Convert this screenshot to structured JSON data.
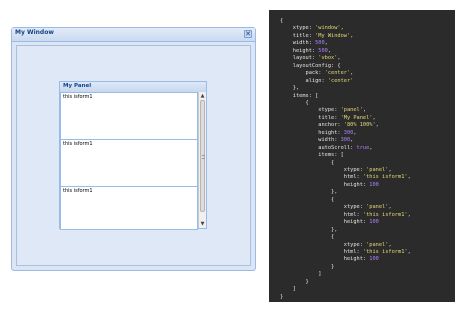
{
  "window": {
    "title": "My Window",
    "close_icon": "close-icon",
    "close_glyph": "✕"
  },
  "panel": {
    "title": "My Panel",
    "forms": [
      {
        "text": "this isform1"
      },
      {
        "text": "this isform1"
      },
      {
        "text": "this isform1"
      }
    ]
  },
  "scrollbar": {
    "up_glyph": "▲",
    "down_glyph": "▼"
  },
  "code": {
    "lines": [
      [
        [
          "p",
          "{"
        ]
      ],
      [
        [
          "p",
          "    xtype: "
        ],
        [
          "s",
          "'window'"
        ],
        [
          "p",
          ","
        ]
      ],
      [
        [
          "p",
          "    title: "
        ],
        [
          "s",
          "'My Window'"
        ],
        [
          "p",
          ","
        ]
      ],
      [
        [
          "p",
          "    width: "
        ],
        [
          "n",
          "500"
        ],
        [
          "p",
          ","
        ]
      ],
      [
        [
          "p",
          "    height: "
        ],
        [
          "n",
          "500"
        ],
        [
          "p",
          ","
        ]
      ],
      [
        [
          "p",
          "    layout: "
        ],
        [
          "s",
          "'vbox'"
        ],
        [
          "p",
          ","
        ]
      ],
      [
        [
          "p",
          "    layoutConfig: {"
        ]
      ],
      [
        [
          "p",
          "        pack: "
        ],
        [
          "s",
          "'center'"
        ],
        [
          "p",
          ","
        ]
      ],
      [
        [
          "p",
          "        align: "
        ],
        [
          "s",
          "'center'"
        ]
      ],
      [
        [
          "p",
          "    },"
        ]
      ],
      [
        [
          "p",
          "    items: ["
        ]
      ],
      [
        [
          "p",
          "        {"
        ]
      ],
      [
        [
          "p",
          "            xtype: "
        ],
        [
          "s",
          "'panel'"
        ],
        [
          "p",
          ","
        ]
      ],
      [
        [
          "p",
          "            title: "
        ],
        [
          "s",
          "'My Panel'"
        ],
        [
          "p",
          ","
        ]
      ],
      [
        [
          "p",
          "            anchor: "
        ],
        [
          "s",
          "'80% 100%'"
        ],
        [
          "p",
          ","
        ]
      ],
      [
        [
          "p",
          "            height: "
        ],
        [
          "n",
          "300"
        ],
        [
          "p",
          ","
        ]
      ],
      [
        [
          "p",
          "            width: "
        ],
        [
          "n",
          "300"
        ],
        [
          "p",
          ","
        ]
      ],
      [
        [
          "p",
          "            autoScroll: "
        ],
        [
          "b",
          "true"
        ],
        [
          "p",
          ","
        ]
      ],
      [
        [
          "p",
          "            items: ["
        ]
      ],
      [
        [
          "p",
          "                {"
        ]
      ],
      [
        [
          "p",
          "                    xtype: "
        ],
        [
          "s",
          "'panel'"
        ],
        [
          "p",
          ","
        ]
      ],
      [
        [
          "p",
          "                    html: "
        ],
        [
          "s",
          "'this isform1'"
        ],
        [
          "p",
          ","
        ]
      ],
      [
        [
          "p",
          "                    height: "
        ],
        [
          "n",
          "100"
        ]
      ],
      [
        [
          "p",
          "                },"
        ]
      ],
      [
        [
          "p",
          "                {"
        ]
      ],
      [
        [
          "p",
          "                    xtype: "
        ],
        [
          "s",
          "'panel'"
        ],
        [
          "p",
          ","
        ]
      ],
      [
        [
          "p",
          "                    html: "
        ],
        [
          "s",
          "'this isform1'"
        ],
        [
          "p",
          ","
        ]
      ],
      [
        [
          "p",
          "                    height: "
        ],
        [
          "n",
          "100"
        ]
      ],
      [
        [
          "p",
          "                },"
        ]
      ],
      [
        [
          "p",
          "                {"
        ]
      ],
      [
        [
          "p",
          "                    xtype: "
        ],
        [
          "s",
          "'panel'"
        ],
        [
          "p",
          ","
        ]
      ],
      [
        [
          "p",
          "                    html: "
        ],
        [
          "s",
          "'this isform1'"
        ],
        [
          "p",
          ","
        ]
      ],
      [
        [
          "p",
          "                    height: "
        ],
        [
          "n",
          "100"
        ]
      ],
      [
        [
          "p",
          "                }"
        ]
      ],
      [
        [
          "p",
          "            ]"
        ]
      ],
      [
        [
          "p",
          "        }"
        ]
      ],
      [
        [
          "p",
          "    ]"
        ]
      ],
      [
        [
          "p",
          "}"
        ]
      ]
    ]
  }
}
